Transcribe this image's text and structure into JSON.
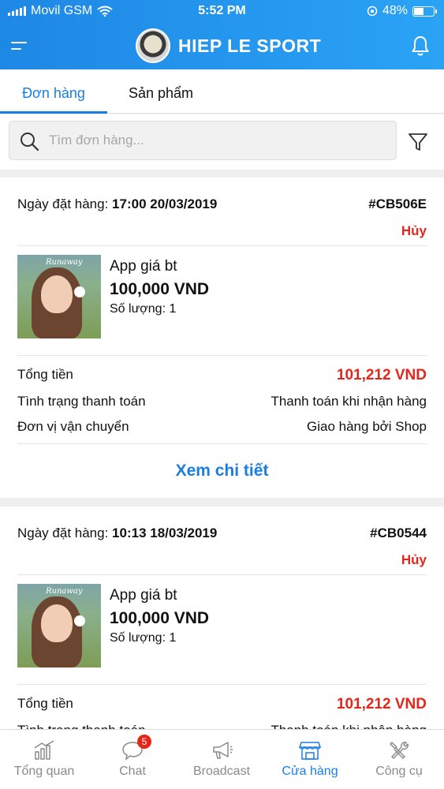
{
  "status_bar": {
    "carrier": "Movil GSM",
    "time": "5:52 PM",
    "battery_percent": "48%",
    "battery_level": 0.48,
    "icons": [
      "signal-icon",
      "wifi-icon",
      "orientation-lock-icon",
      "battery-icon"
    ]
  },
  "header": {
    "title": "HIEP LE SPORT",
    "icons": [
      "menu-icon",
      "store-logo",
      "bell-icon"
    ],
    "gradient_colors": [
      "#1e88e5",
      "#2aa3f5"
    ]
  },
  "tabs": [
    {
      "label": "Đơn hàng",
      "active": true
    },
    {
      "label": "Sản phẩm",
      "active": false
    }
  ],
  "search": {
    "placeholder": "Tìm đơn hàng..."
  },
  "orders": [
    {
      "date_label": "Ngày đặt hàng:",
      "date": "17:00 20/03/2019",
      "code": "#CB506E",
      "status": "Hủy",
      "product_name": "App giá bt",
      "product_price": "100,000 VND",
      "quantity": "Số lượng: 1",
      "total_label": "Tổng tiền",
      "total_value": "101,212 VND",
      "payment_label": "Tình trạng thanh toán",
      "payment_value": "Thanh toán khi nhận hàng",
      "shipping_label": "Đơn vị vận chuyển",
      "shipping_value": "Giao hàng bởi Shop",
      "detail_button": "Xem chi tiết"
    },
    {
      "date_label": "Ngày đặt hàng:",
      "date": "10:13 18/03/2019",
      "code": "#CB0544",
      "status": "Hủy",
      "product_name": "App giá bt",
      "product_price": "100,000 VND",
      "quantity": "Số lượng: 1",
      "total_label": "Tổng tiền",
      "total_value": "101,212 VND",
      "payment_label": "Tình trạng thanh toán",
      "payment_value": "Thanh toán khi nhận hàng"
    }
  ],
  "bottom_nav": [
    {
      "label": "Tổng quan",
      "icon": "chart-icon",
      "active": false
    },
    {
      "label": "Chat",
      "icon": "chat-icon",
      "badge": "5",
      "active": false
    },
    {
      "label": "Broadcast",
      "icon": "megaphone-icon",
      "active": false
    },
    {
      "label": "Cửa hàng",
      "icon": "store-icon",
      "active": true
    },
    {
      "label": "Công cụ",
      "icon": "tools-icon",
      "active": false
    }
  ],
  "colors": {
    "accent": "#1a7ee0",
    "danger": "#e5261b"
  }
}
